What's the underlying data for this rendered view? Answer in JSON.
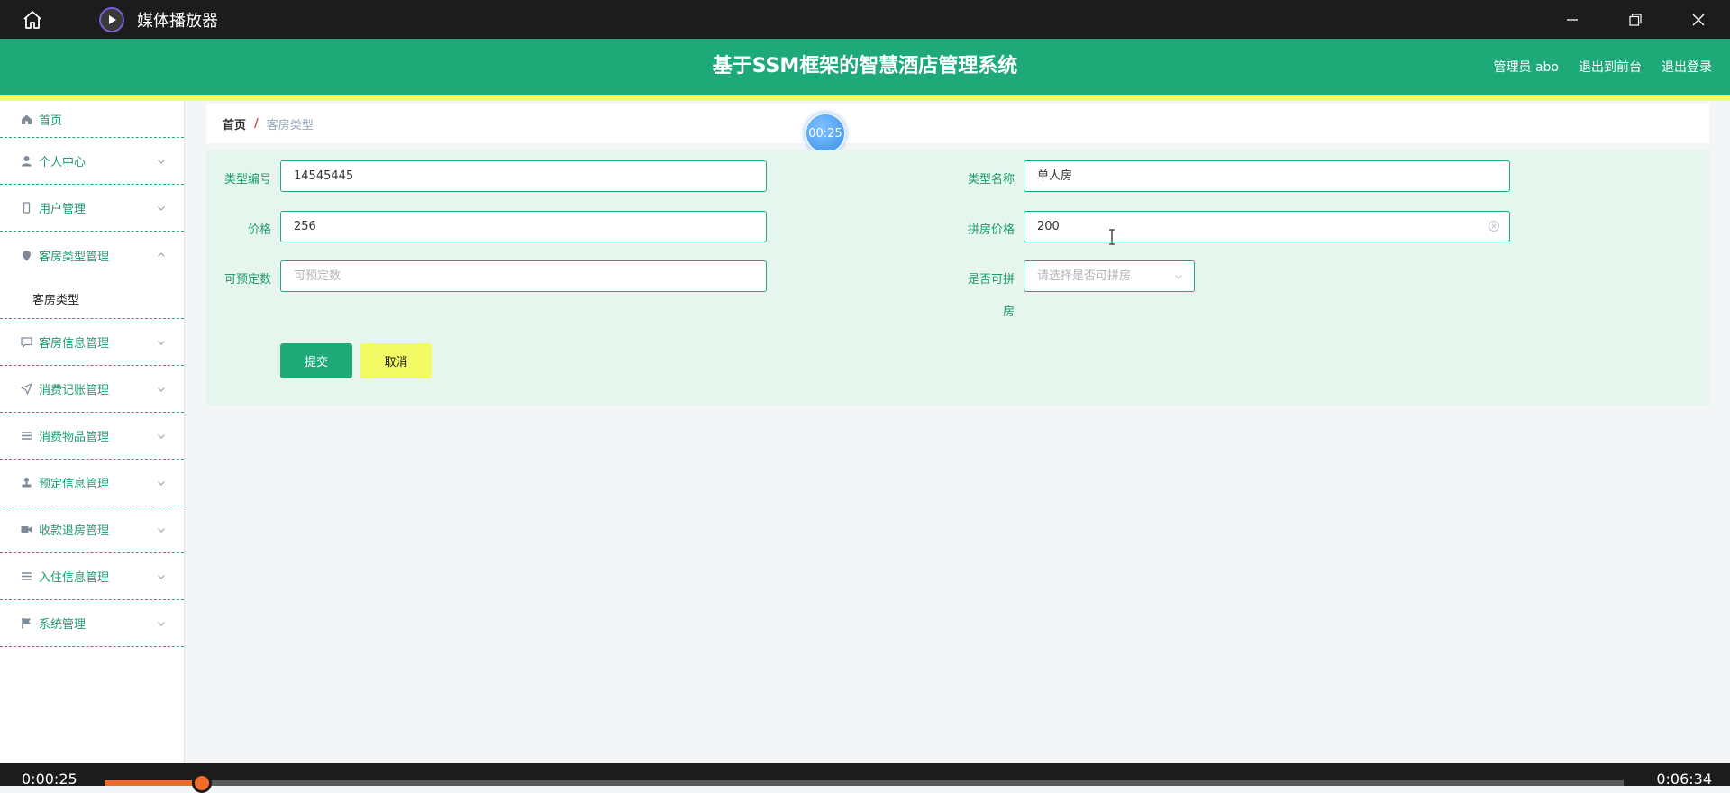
{
  "player": {
    "title": "媒体播放器",
    "time_current": "0:00:25",
    "time_total": "0:06:34",
    "progress": 0.064,
    "timer_bubble": "00:25",
    "accent": "#f06a2a"
  },
  "header": {
    "title": "基于SSM框架的智慧酒店管理系统",
    "user": "管理员 abo",
    "back_front": "退出到前台",
    "logout": "退出登录",
    "bg": "#1eaa78",
    "stripe": "#f2fb63"
  },
  "sidebar": {
    "items": [
      {
        "label": "首页",
        "icon": "home-icon"
      },
      {
        "label": "个人中心",
        "icon": "user-icon"
      },
      {
        "label": "用户管理",
        "icon": "phone-icon"
      },
      {
        "label": "客房类型管理",
        "icon": "pin-icon",
        "expanded": true,
        "sub": "客房类型"
      },
      {
        "label": "客房信息管理",
        "icon": "chat-icon"
      },
      {
        "label": "消费记账管理",
        "icon": "send-icon"
      },
      {
        "label": "消费物品管理",
        "icon": "list-icon"
      },
      {
        "label": "预定信息管理",
        "icon": "stamp-icon"
      },
      {
        "label": "收款退房管理",
        "icon": "camera-icon"
      },
      {
        "label": "入住信息管理",
        "icon": "list-icon"
      },
      {
        "label": "系统管理",
        "icon": "flag-icon"
      }
    ]
  },
  "breadcrumb": {
    "home": "首页",
    "sep": "/",
    "current": "客房类型"
  },
  "form": {
    "type_code_label": "类型编号",
    "type_code_value": "14545445",
    "type_name_label": "类型名称",
    "type_name_value": "单人房",
    "price_label": "价格",
    "price_value": "256",
    "share_price_label": "拼房价格",
    "share_price_value": "200",
    "bookable_label": "可预定数",
    "bookable_placeholder": "可预定数",
    "can_share_label_1": "是否可拼",
    "can_share_label_2": "房",
    "can_share_placeholder": "请选择是否可拼房",
    "submit": "提交",
    "cancel": "取消"
  }
}
